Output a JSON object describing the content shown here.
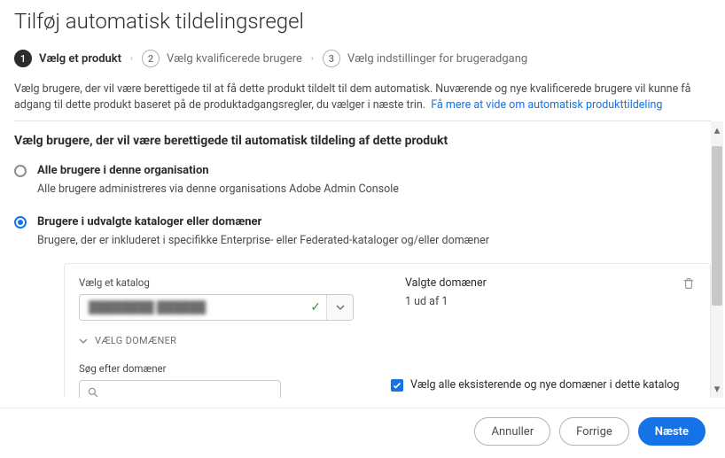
{
  "title": "Tilføj automatisk tildelingsregel",
  "steps": [
    {
      "num": "1",
      "label": "Vælg et produkt",
      "active": true
    },
    {
      "num": "2",
      "label": "Vælg kvalificerede brugere",
      "active": false
    },
    {
      "num": "3",
      "label": "Vælg indstillinger for brugeradgang",
      "active": false
    }
  ],
  "intro": "Vælg brugere, der vil være berettigede til at få dette produkt tildelt til dem automatisk. Nuværende og nye kvalificerede brugere vil kunne få adgang til dette produkt baseret på de produktadgangsregler, du vælger i næste trin.",
  "intro_link": "Få mere at vide om automatisk produkttildeling",
  "section_heading": "Vælg brugere, der vil være berettigede til automatisk tildeling af dette produkt",
  "options": {
    "all": {
      "label": "Alle brugere i denne organisation",
      "desc": "Alle brugere administreres via denne organisations Adobe Admin Console"
    },
    "selected": {
      "label": "Brugere i udvalgte kataloger eller domæner",
      "desc": "Brugere, der er inkluderet i specifikke Enterprise- eller Federated-kataloger og/eller domæner"
    }
  },
  "catalog": {
    "field_label": "Vælg et katalog",
    "value_redacted": "████████ ██████",
    "selected_title": "Valgte domæner",
    "selected_count": "1 ud af 1",
    "domains_toggle": "VÆLG DOMÆNER",
    "search_label": "Søg efter domæner",
    "search_placeholder": "",
    "check_all_label": "Vælg alle eksisterende og nye domæner i dette katalog"
  },
  "footer": {
    "cancel": "Annuller",
    "prev": "Forrige",
    "next": "Næste"
  }
}
